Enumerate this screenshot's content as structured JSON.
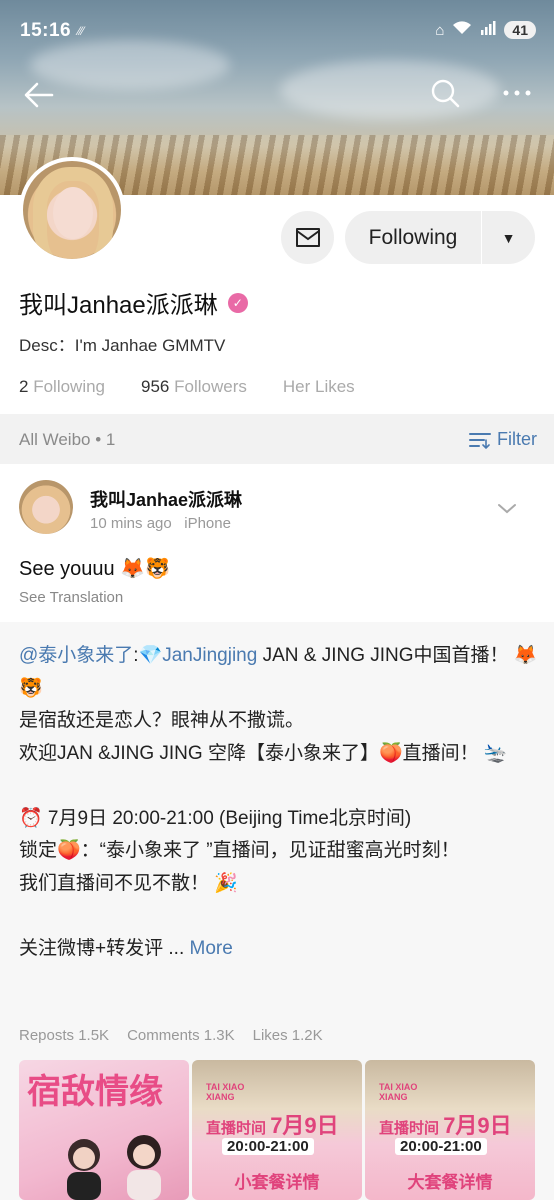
{
  "status": {
    "time": "15:16",
    "battery": "41"
  },
  "profile": {
    "name": "我叫Janhae派派琳",
    "verified_mark": "✓",
    "desc": "Desc：I'm Janhae  GMMTV",
    "following_count": "2",
    "following_label": "Following",
    "followers_count": "956",
    "followers_label": "Followers",
    "likes_label": "Her Likes",
    "follow_button": "Following"
  },
  "feed_bar": {
    "all_weibo": "All Weibo • 1",
    "filter": "Filter"
  },
  "post": {
    "author": "我叫Janhae派派琳",
    "time": "10  mins ago",
    "device": "iPhone",
    "text": "See youuu 🦊🐯",
    "translation": "See Translation"
  },
  "repost": {
    "mention": "@泰小象来了",
    "colon": ":",
    "tag": "💎JanJingjing",
    "line1_rest": " JAN & JING JING中国首播！ 🦊🐯",
    "line2": "是宿敌还是恋人？眼神从不撒谎。",
    "line3": "欢迎JAN &JING JING 空降【泰小象来了】🍑直播间！ 🛬",
    "line4": "⏰ 7月9日 20:00-21:00 (Beijing Time北京时间)",
    "line5": "锁定🍑：“泰小象来了 ”直播间，见证甜蜜高光时刻！",
    "line6": "我们直播间不见不散！ 🎉",
    "line7": "关注微博+转发评",
    "ellipsis": " ... ",
    "more": "More",
    "reposts": "Reposts 1.5K",
    "comments": "Comments 1.3K",
    "likes": "Likes 1.2K"
  },
  "thumbnails": [
    {
      "title_a": "宿敌",
      "title_b": "情缘"
    },
    {
      "brand": "TAI XIAO XIANG",
      "live_label": "直播时间",
      "date": "7月9日",
      "range": "20:00-21:00",
      "package": "小套餐详情"
    },
    {
      "brand": "TAI XIAO XIANG",
      "live_label": "直播时间",
      "date": "7月9日",
      "range": "20:00-21:00",
      "package": "大套餐详情"
    }
  ],
  "colors": {
    "link": "#4a7ab0",
    "verified": "#e96aa6",
    "pink_accent": "#e0437c"
  }
}
